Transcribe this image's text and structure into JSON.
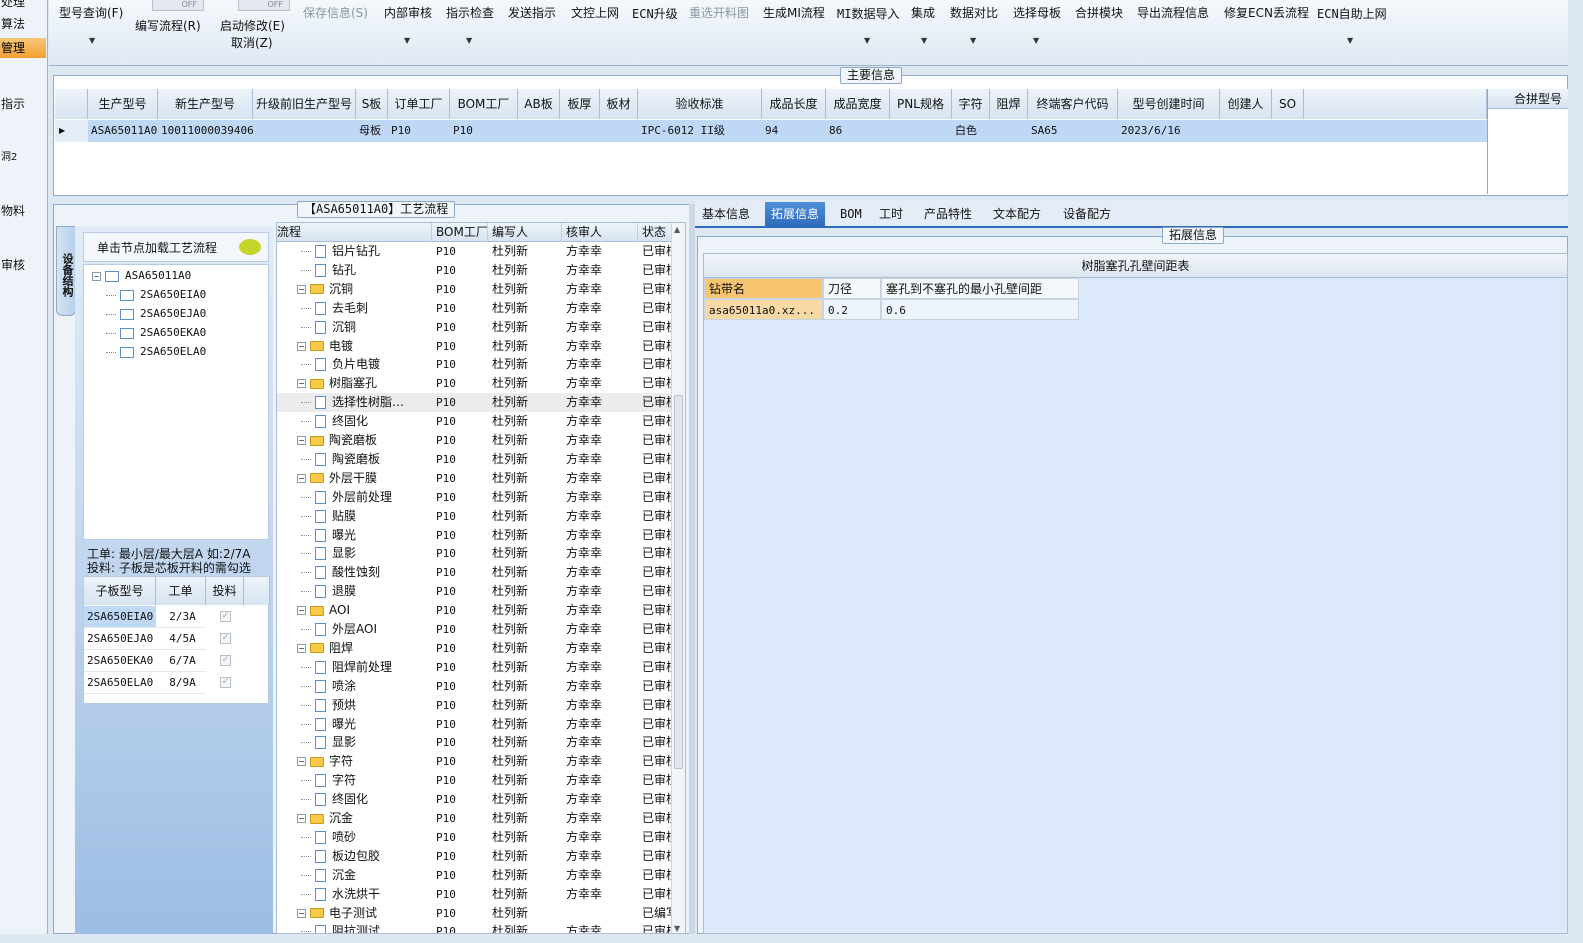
{
  "left_nav": [
    "处理",
    "算法",
    "管理",
    "指示",
    "洞2",
    "物料",
    "审核"
  ],
  "toolbar": {
    "buttons": [
      "型号查询(F)",
      "编写流程(R)",
      "启动修改(E)",
      "取消(Z)",
      "保存信息(S)",
      "内部审核",
      "指示检查",
      "发送指示",
      "文控上网",
      "ECN升级",
      "重选开料图",
      "生成MI流程",
      "MI数据导入",
      "集成",
      "数据对比",
      "选择母板",
      "合拼模块",
      "导出流程信息",
      "修复ECN丢流程",
      "ECN自助上网"
    ],
    "toggle_off": "OFF"
  },
  "main_info": {
    "legend": "主要信息",
    "columns": [
      "生产型号",
      "新生产型号",
      "升级前旧生产型号",
      "S板",
      "订单工厂",
      "BOM工厂",
      "AB板",
      "板厚",
      "板材",
      "验收标准",
      "成品长度",
      "成品宽度",
      "PNL规格",
      "字符",
      "阻焊",
      "终端客户代码",
      "型号创建时间",
      "创建人",
      "SO"
    ],
    "row": [
      "ASA65011A0",
      "10011000039406",
      "",
      "母板",
      "P10",
      "P10",
      "",
      "",
      "",
      "IPC-6012 II级",
      "94",
      "86",
      "",
      "白色",
      "",
      "SA65",
      "2023/6/16",
      "",
      ""
    ],
    "side_header": "合拼型号"
  },
  "process": {
    "legend": "【ASA65011A0】工艺流程",
    "side_tab": "设备结构",
    "load_hint": "单击节点加载工艺流程",
    "tree_root": "ASA65011A0",
    "tree_children": [
      "2SA650EIA0",
      "2SA650EJA0",
      "2SA650EKA0",
      "2SA650ELA0"
    ],
    "notes": [
      "工单: 最小层/最大层A 如:2/7A",
      "投料: 子板是芯板开料的需勾选"
    ],
    "sub_table": {
      "columns": [
        "子板型号",
        "工单",
        "投料"
      ],
      "rows": [
        [
          "2SA650EIA0",
          "2/3A"
        ],
        [
          "2SA650EJA0",
          "4/5A"
        ],
        [
          "2SA650EKA0",
          "6/7A"
        ],
        [
          "2SA650ELA0",
          "8/9A"
        ]
      ]
    }
  },
  "flow_table": {
    "columns": [
      "流程",
      "BOM工厂",
      "编写人",
      "核审人",
      "状态"
    ],
    "rows": [
      {
        "name": "铝片钻孔",
        "type": "leaf",
        "bom": "P10",
        "writer": "杜列新",
        "reviewer": "方幸幸",
        "status": "已审核"
      },
      {
        "name": "钻孔",
        "type": "leaf",
        "bom": "P10",
        "writer": "杜列新",
        "reviewer": "方幸幸",
        "status": "已审核"
      },
      {
        "name": "沉铜",
        "type": "folder",
        "bom": "P10",
        "writer": "杜列新",
        "reviewer": "方幸幸",
        "status": "已审核"
      },
      {
        "name": "去毛刺",
        "type": "leaf",
        "bom": "P10",
        "writer": "杜列新",
        "reviewer": "方幸幸",
        "status": "已审核"
      },
      {
        "name": "沉铜",
        "type": "leaf",
        "bom": "P10",
        "writer": "杜列新",
        "reviewer": "方幸幸",
        "status": "已审核"
      },
      {
        "name": "电镀",
        "type": "folder",
        "bom": "P10",
        "writer": "杜列新",
        "reviewer": "方幸幸",
        "status": "已审核"
      },
      {
        "name": "负片电镀",
        "type": "leaf",
        "bom": "P10",
        "writer": "杜列新",
        "reviewer": "方幸幸",
        "status": "已审核"
      },
      {
        "name": "树脂塞孔",
        "type": "folder",
        "bom": "P10",
        "writer": "杜列新",
        "reviewer": "方幸幸",
        "status": "已审核"
      },
      {
        "name": "选择性树脂…",
        "type": "leaf",
        "bom": "P10",
        "writer": "杜列新",
        "reviewer": "方幸幸",
        "status": "已审核",
        "selected": true
      },
      {
        "name": "终固化",
        "type": "leaf",
        "bom": "P10",
        "writer": "杜列新",
        "reviewer": "方幸幸",
        "status": "已审核"
      },
      {
        "name": "陶瓷磨板",
        "type": "folder",
        "bom": "P10",
        "writer": "杜列新",
        "reviewer": "方幸幸",
        "status": "已审核"
      },
      {
        "name": "陶瓷磨板",
        "type": "leaf",
        "bom": "P10",
        "writer": "杜列新",
        "reviewer": "方幸幸",
        "status": "已审核"
      },
      {
        "name": "外层干膜",
        "type": "folder",
        "bom": "P10",
        "writer": "杜列新",
        "reviewer": "方幸幸",
        "status": "已审核"
      },
      {
        "name": "外层前处理",
        "type": "leaf",
        "bom": "P10",
        "writer": "杜列新",
        "reviewer": "方幸幸",
        "status": "已审核"
      },
      {
        "name": "贴膜",
        "type": "leaf",
        "bom": "P10",
        "writer": "杜列新",
        "reviewer": "方幸幸",
        "status": "已审核"
      },
      {
        "name": "曝光",
        "type": "leaf",
        "bom": "P10",
        "writer": "杜列新",
        "reviewer": "方幸幸",
        "status": "已审核"
      },
      {
        "name": "显影",
        "type": "leaf",
        "bom": "P10",
        "writer": "杜列新",
        "reviewer": "方幸幸",
        "status": "已审核"
      },
      {
        "name": "酸性蚀刻",
        "type": "leaf",
        "bom": "P10",
        "writer": "杜列新",
        "reviewer": "方幸幸",
        "status": "已审核"
      },
      {
        "name": "退膜",
        "type": "leaf",
        "bom": "P10",
        "writer": "杜列新",
        "reviewer": "方幸幸",
        "status": "已审核"
      },
      {
        "name": "AOI",
        "type": "folder",
        "bom": "P10",
        "writer": "杜列新",
        "reviewer": "方幸幸",
        "status": "已审核"
      },
      {
        "name": "外层AOI",
        "type": "leaf",
        "bom": "P10",
        "writer": "杜列新",
        "reviewer": "方幸幸",
        "status": "已审核"
      },
      {
        "name": "阻焊",
        "type": "folder",
        "bom": "P10",
        "writer": "杜列新",
        "reviewer": "方幸幸",
        "status": "已审核"
      },
      {
        "name": "阻焊前处理",
        "type": "leaf",
        "bom": "P10",
        "writer": "杜列新",
        "reviewer": "方幸幸",
        "status": "已审核"
      },
      {
        "name": "喷涂",
        "type": "leaf",
        "bom": "P10",
        "writer": "杜列新",
        "reviewer": "方幸幸",
        "status": "已审核"
      },
      {
        "name": "预烘",
        "type": "leaf",
        "bom": "P10",
        "writer": "杜列新",
        "reviewer": "方幸幸",
        "status": "已审核"
      },
      {
        "name": "曝光",
        "type": "leaf",
        "bom": "P10",
        "writer": "杜列新",
        "reviewer": "方幸幸",
        "status": "已审核"
      },
      {
        "name": "显影",
        "type": "leaf",
        "bom": "P10",
        "writer": "杜列新",
        "reviewer": "方幸幸",
        "status": "已审核"
      },
      {
        "name": "字符",
        "type": "folder",
        "bom": "P10",
        "writer": "杜列新",
        "reviewer": "方幸幸",
        "status": "已审核"
      },
      {
        "name": "字符",
        "type": "leaf",
        "bom": "P10",
        "writer": "杜列新",
        "reviewer": "方幸幸",
        "status": "已审核"
      },
      {
        "name": "终固化",
        "type": "leaf",
        "bom": "P10",
        "writer": "杜列新",
        "reviewer": "方幸幸",
        "status": "已审核"
      },
      {
        "name": "沉金",
        "type": "folder",
        "bom": "P10",
        "writer": "杜列新",
        "reviewer": "方幸幸",
        "status": "已审核"
      },
      {
        "name": "喷砂",
        "type": "leaf",
        "bom": "P10",
        "writer": "杜列新",
        "reviewer": "方幸幸",
        "status": "已审核"
      },
      {
        "name": "板边包胶",
        "type": "leaf",
        "bom": "P10",
        "writer": "杜列新",
        "reviewer": "方幸幸",
        "status": "已审核"
      },
      {
        "name": "沉金",
        "type": "leaf",
        "bom": "P10",
        "writer": "杜列新",
        "reviewer": "方幸幸",
        "status": "已审核"
      },
      {
        "name": "水洗烘干",
        "type": "leaf",
        "bom": "P10",
        "writer": "杜列新",
        "reviewer": "方幸幸",
        "status": "已审核"
      },
      {
        "name": "电子测试",
        "type": "folder",
        "bom": "P10",
        "writer": "杜列新",
        "reviewer": "",
        "status": "已编写"
      },
      {
        "name": "阻抗测试",
        "type": "leaf",
        "bom": "P10",
        "writer": "杜列新",
        "reviewer": "方幸幸",
        "status": "已审核"
      }
    ]
  },
  "detail": {
    "tabs": [
      "基本信息",
      "拓展信息",
      "BOM",
      "工时",
      "产品特性",
      "文本配方",
      "设备配方"
    ],
    "active_tab": "拓展信息",
    "legend": "拓展信息",
    "table_title": "树脂塞孔孔壁间距表",
    "columns": [
      "钻带名",
      "刀径",
      "塞孔到不塞孔的最小孔壁间距"
    ],
    "rows": [
      [
        "asa65011a0.xz...",
        "0.2",
        "0.6"
      ]
    ]
  },
  "colors": {
    "selected_row": "#bfd8f5",
    "accent": "#2e6bbd",
    "nav_selected": "#f0a030"
  }
}
